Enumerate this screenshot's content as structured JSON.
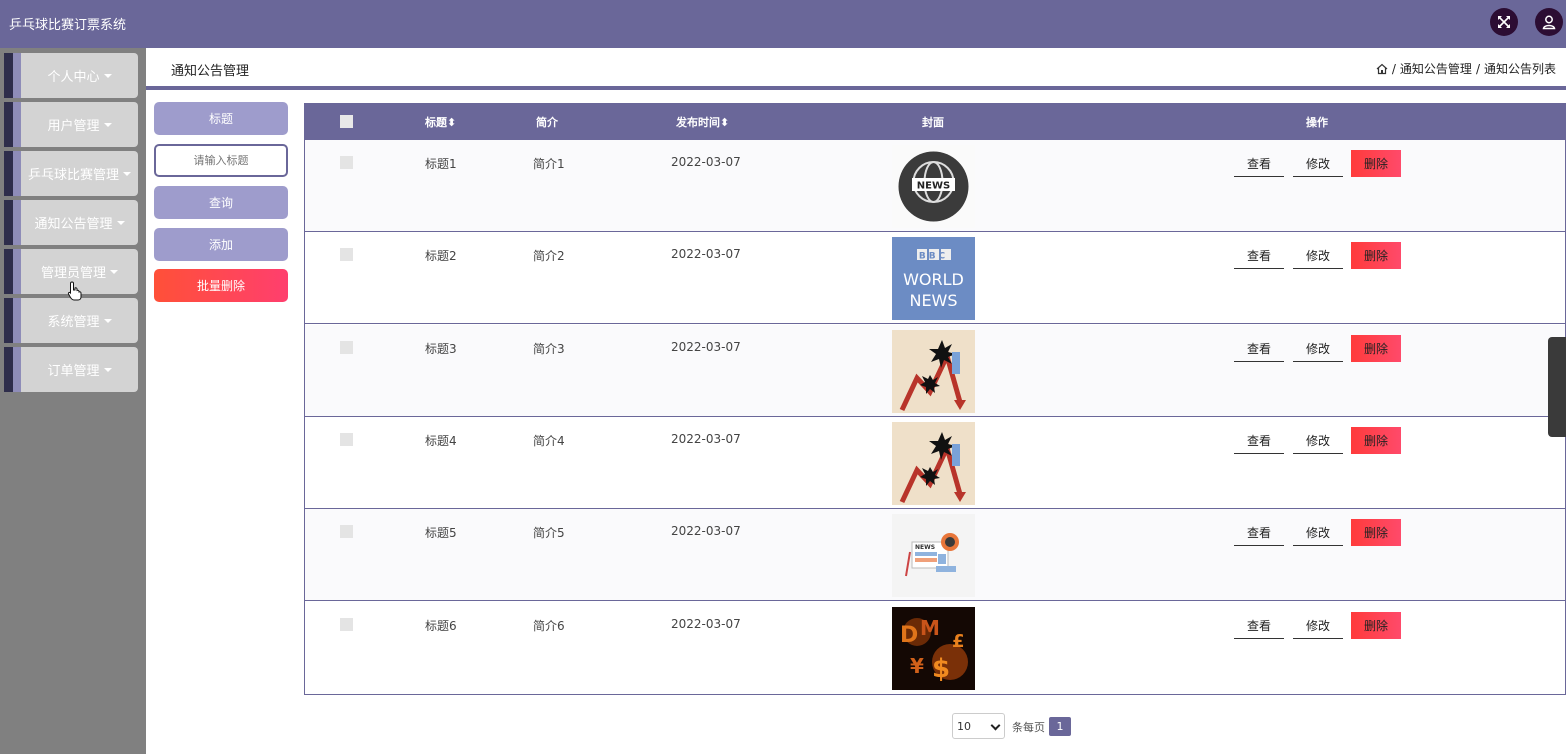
{
  "app": {
    "title": "乒乓球比赛订票系统"
  },
  "topbar": {
    "icons": [
      "fullscreen-icon",
      "user-icon"
    ]
  },
  "sidebar": {
    "items": [
      {
        "label": "个人中心"
      },
      {
        "label": "用户管理"
      },
      {
        "label": "乒乓球比赛管理"
      },
      {
        "label": "通知公告管理"
      },
      {
        "label": "管理员管理"
      },
      {
        "label": "系统管理"
      },
      {
        "label": "订单管理"
      }
    ]
  },
  "header": {
    "title": "通知公告管理",
    "breadcrumb": [
      "通知公告管理",
      "通知公告列表"
    ],
    "sep": "/"
  },
  "search": {
    "label": "标题",
    "placeholder": "请输入标题",
    "query_button": "查询",
    "add_button": "添加",
    "batch_delete_button": "批量删除"
  },
  "table": {
    "columns": [
      "标题",
      "简介",
      "发布时间",
      "封面",
      "操作"
    ],
    "sort_glyph": "⬍",
    "actions": {
      "view": "查看",
      "edit": "修改",
      "delete": "删除"
    },
    "rows": [
      {
        "title": "标题1",
        "intro": "简介1",
        "date": "2022-03-07",
        "cover": "news-globe-image"
      },
      {
        "title": "标题2",
        "intro": "简介2",
        "date": "2022-03-07",
        "cover": "bbc-world-news-image"
      },
      {
        "title": "标题3",
        "intro": "简介3",
        "date": "2022-03-07",
        "cover": "falling-chart-image"
      },
      {
        "title": "标题4",
        "intro": "简介4",
        "date": "2022-03-07",
        "cover": "falling-chart-image"
      },
      {
        "title": "标题5",
        "intro": "简介5",
        "date": "2022-03-07",
        "cover": "news-illustration-image"
      },
      {
        "title": "标题6",
        "intro": "简介6",
        "date": "2022-03-07",
        "cover": "currency-symbols-image"
      }
    ],
    "bbc_text": {
      "line1": "BBC",
      "line2": "WORLD",
      "line3": "NEWS"
    },
    "news_text": "NEWS"
  },
  "pagination": {
    "page_size": "10",
    "per_page_label": "条每页",
    "current_page": "1"
  },
  "colors": {
    "accent": "#6a6799",
    "sidebar_bg": "#808080",
    "delete": "#ff3b3b"
  }
}
